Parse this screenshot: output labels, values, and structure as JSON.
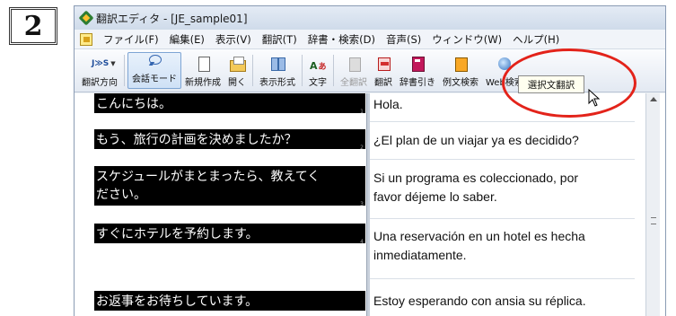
{
  "step_number": "2",
  "window": {
    "title": "翻訳エディタ - [JE_sample01]"
  },
  "menubar": {
    "items": [
      "ファイル(F)",
      "編集(E)",
      "表示(V)",
      "翻訳(T)",
      "辞書・検索(D)",
      "音声(S)",
      "ウィンドウ(W)",
      "ヘルプ(H)"
    ]
  },
  "toolbar": {
    "direction_label": "翻訳方向",
    "direction_icon_text": "J≫S",
    "conversation_mode_label": "会話モード",
    "new_label": "新規作成",
    "open_label": "開く",
    "view_format_label": "表示形式",
    "character_label": "文字",
    "translate_all_label": "全翻訳",
    "translate_label": "翻訳",
    "dictionary_lookup_label": "辞書引き",
    "example_search_label": "例文検索",
    "web_search_label": "Web検索"
  },
  "tooltip": {
    "text": "選択文翻訳"
  },
  "segments": [
    {
      "source": "こんにちは。",
      "target": "Hola."
    },
    {
      "source": "もう、旅行の計画を決めましたか？",
      "target": "¿El plan de un viajar ya es decidido?"
    },
    {
      "source_line1": "スケジュールがまとまったら、教えてく",
      "source_line2": "ださい。",
      "target_line1": "Si un programa es coleccionado, por",
      "target_line2": "favor déjeme lo saber."
    },
    {
      "source": "すぐにホテルを予約します。",
      "target_line1": "Una reservación en un hotel es hecha",
      "target_line2": "inmediatamente."
    },
    {
      "source": "お返事をお待ちしています。",
      "target": "Estoy esperando con ansia su réplica."
    }
  ],
  "colors": {
    "highlight_ring": "#e3231a",
    "source_bg": "#000000",
    "source_text": "#ffffff"
  },
  "icons": {
    "app": "app-logo-icon",
    "file_menu": "menu-app-icon",
    "direction": "js-direction-icon",
    "conversation": "speech-bubble-icon",
    "new": "new-document-icon",
    "open": "open-folder-icon",
    "view": "view-format-icon",
    "character": "character-icon",
    "translate_all": "translate-all-icon",
    "translate": "translate-icon",
    "dictionary": "dictionary-icon",
    "example": "example-search-icon",
    "web": "globe-icon",
    "cursor": "mouse-cursor-icon"
  }
}
